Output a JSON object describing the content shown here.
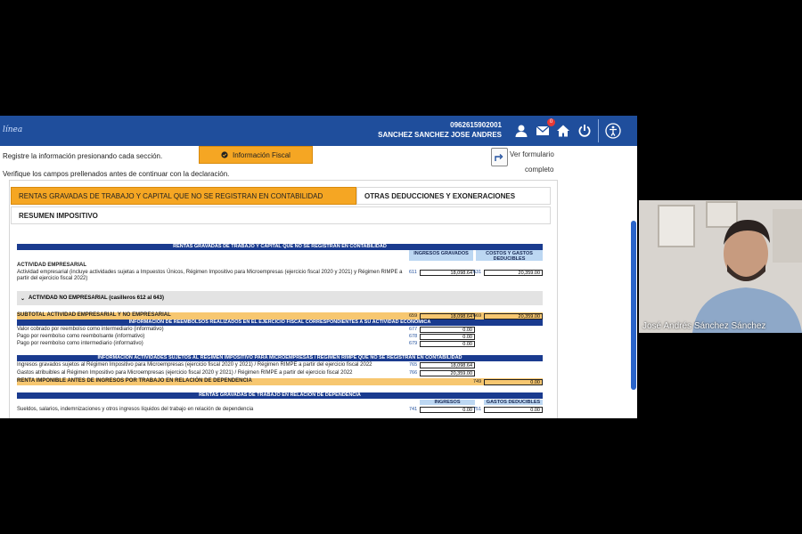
{
  "header": {
    "brand": "línea",
    "user_id": "0962615902001",
    "user_name": "SANCHEZ SANCHEZ JOSE ANDRES",
    "mail_badge": "0",
    "icons": [
      "user-icon",
      "mail-icon",
      "home-icon",
      "power-icon",
      "accessibility-icon"
    ]
  },
  "instructions": {
    "line1": "Registre la información presionando cada sección.",
    "line2": "Verifique los campos prellenados antes de continuar con la declaración."
  },
  "section_button": "Información Fiscal",
  "view_form": {
    "line1": "Ver formulario",
    "line2": "completo"
  },
  "tabs": [
    {
      "label": "RENTAS GRAVADAS DE TRABAJO Y CAPITAL QUE NO SE REGISTRAN EN CONTABILIDAD",
      "active": true
    },
    {
      "label": "OTRAS DEDUCCIONES Y EXONERACIONES",
      "active": false
    },
    {
      "label": "RESUMEN IMPOSITIVO",
      "active": false
    }
  ],
  "sheet": {
    "title1": "RENTAS GRAVADAS DE TRABAJO Y CAPITAL QUE NO SE REGISTRAN EN CONTABILIDAD",
    "col_ingresos": "INGRESOS GRAVADOS",
    "col_costos": "COSTOS Y GASTOS DEDUCIBLES",
    "act_emp_title": "ACTIVIDAD EMPRESARIAL",
    "act_emp_desc": "Actividad empresarial (incluye actividades sujetas a Impuestos Únicos, Régimen Impositivo para Microempresas (ejercicio fiscal 2020 y 2021) y Régimen RIMPE a partir del ejercicio fiscal 2022)",
    "act_emp_code1": "611",
    "act_emp_val1": "18,098.64",
    "act_emp_code2": "631",
    "act_emp_val2": "20,359.00",
    "act_no_emp": "ACTIVIDAD NO EMPRESARIAL (casilleros 612 al 643)",
    "subtotal_label": "SUBTOTAL ACTIVIDAD EMPRESARIAL Y NO EMPRESARIAL",
    "subtotal_code1": "659",
    "subtotal_val1": "18,098.64",
    "subtotal_code2": "669",
    "subtotal_val2": "20,359.00",
    "reemb_title": "INFORMACIÓN DE REEMBOLSOS REALIZADOS EN EL EJERCICIO FISCAL CORRESPONDIENTES A SU ACTIVIDAD ECONÓMICA",
    "reemb_rows": [
      {
        "label": "Valor cobrado por reembolso como intermediario (informativo)",
        "code": "677",
        "value": "0.00"
      },
      {
        "label": "Pago por reembolso como reembolsante (informativo)",
        "code": "678",
        "value": "0.00"
      },
      {
        "label": "Pago por reembolso como intermediario (informativo)",
        "code": "679",
        "value": "0.00"
      }
    ],
    "rimpe_title": "INFORMACIÓN ACTIVIDADES SUJETOS AL RÉGIMEN IMPOSITIVO PARA MICROEMPRESAS / RÉGIMEN RIMPE QUE NO SE REGISTRAN EN CONTABILIDAD",
    "rimpe_rows": [
      {
        "label": "Ingresos gravados sujetos al Régimen Impositivo para Microempresas (ejercicio fiscal 2020 y 2021) / Régimen RIMPE a partir del ejercicio fiscal 2022",
        "code": "765",
        "value": "18,098.64"
      },
      {
        "label": "Gastos atribuibles al Régimen Impositivo para Microempresas (ejercicio fiscal 2020 y 2021) / Régimen RIMPE a partir del ejercicio fiscal 2022",
        "code": "766",
        "value": "20,359.00"
      }
    ],
    "renta_label": "RENTA IMPONIBLE ANTES DE INGRESOS POR TRABAJO EN RELACIÓN DE DEPENDENCIA",
    "renta_code": "749",
    "renta_value": "0.00",
    "dep_title": "RENTAS GRAVADAS DE TRABAJO EN RELACIÓN DE DEPENDENCIA",
    "dep_col1": "INGRESOS",
    "dep_col2": "GASTOS DEDUCIBLES",
    "dep_row_label": "Sueldos, salarios, indemnizaciones y otros ingresos líquidos del trabajo en relación de dependencia",
    "dep_code1": "741",
    "dep_val1": "0.00",
    "dep_code2": "751",
    "dep_val2": "0.00"
  },
  "video": {
    "participant_name": "José Andrés Sánchez Sánchez"
  },
  "colors": {
    "header_blue": "#1f4e9c",
    "accent_orange": "#f5a623",
    "sheet_header": "#1a3b8f"
  }
}
